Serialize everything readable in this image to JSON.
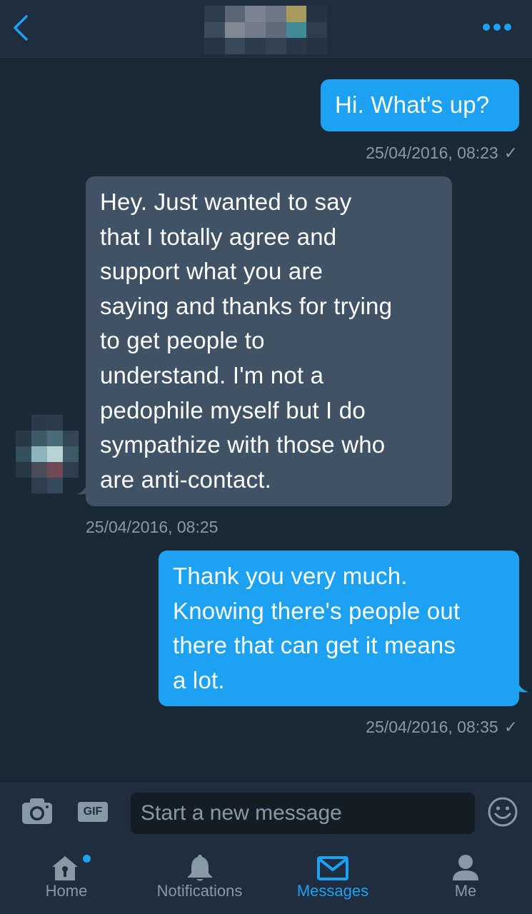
{
  "header": {
    "back_icon": "chevron-left-icon",
    "contact_name": "",
    "more_icon": "more-dots-icon"
  },
  "messages": [
    {
      "direction": "sent",
      "text": "Hi. What's up?",
      "timestamp": "25/04/2016, 08:23",
      "status": "✓"
    },
    {
      "direction": "received",
      "lines": [
        "Hey. Just wanted to say",
        "that I totally agree and",
        "support what you are",
        "saying and thanks for trying",
        "to get people to",
        "understand. I'm not a",
        "pedophile myself but I do",
        "sympathize with those who",
        "are anti-contact."
      ],
      "timestamp": "25/04/2016, 08:25"
    },
    {
      "direction": "sent",
      "lines": [
        "Thank you very much.",
        "Knowing there's people out",
        "there that can get it means",
        "a lot."
      ],
      "timestamp": "25/04/2016, 08:35",
      "status": "✓"
    }
  ],
  "composer": {
    "camera_icon": "camera-icon",
    "gif_label": "GIF",
    "placeholder": "Start a new message",
    "emoji_icon": "emoji-icon"
  },
  "tabs": [
    {
      "label": "Home",
      "icon": "home-icon",
      "active": false,
      "has_dot": true
    },
    {
      "label": "Notifications",
      "icon": "bell-icon",
      "active": false
    },
    {
      "label": "Messages",
      "icon": "envelope-icon",
      "active": true
    },
    {
      "label": "Me",
      "icon": "person-icon",
      "active": false
    }
  ],
  "colors": {
    "accent": "#1da1f2",
    "background": "#1b2836",
    "bar": "#1f2d3e",
    "received_bubble": "#3f5266",
    "muted_text": "#8899a6"
  }
}
